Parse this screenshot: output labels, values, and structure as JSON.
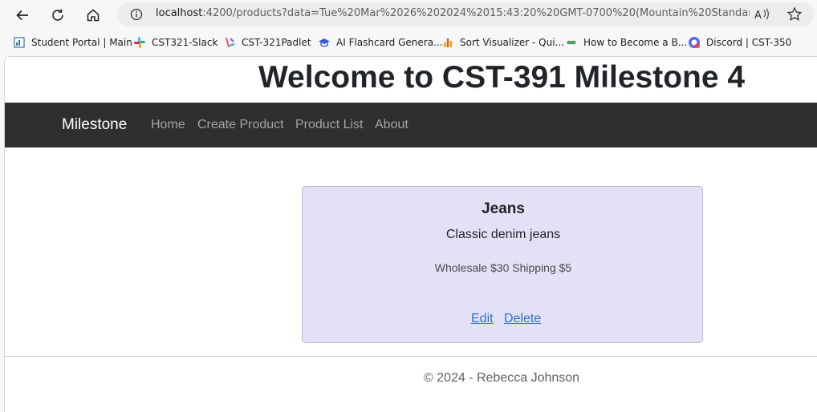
{
  "browser": {
    "url_host": "localhost",
    "url_rest": ":4200/products?data=Tue%20Mar%2026%202024%2015:43:20%20GMT-0700%20(Mountain%20Standard%2...",
    "read_aloud": "A̩)",
    "bookmarks": [
      {
        "label": "Student Portal | Main",
        "icon": "student-portal-icon"
      },
      {
        "label": "CST321-Slack",
        "icon": "slack-icon"
      },
      {
        "label": "CST-321Padlet",
        "icon": "padlet-icon"
      },
      {
        "label": "AI Flashcard Genera...",
        "icon": "graduation-cap-icon"
      },
      {
        "label": "Sort Visualizer - Qui...",
        "icon": "bar-chart-icon"
      },
      {
        "label": "How to Become a B...",
        "icon": "infinity-icon"
      },
      {
        "label": "Discord | CST-350",
        "icon": "discord-icon"
      }
    ]
  },
  "page": {
    "heading": "Welcome to CST-391 Milestone 4",
    "navbar": {
      "brand": "Milestone",
      "links": [
        "Home",
        "Create Product",
        "Product List",
        "About"
      ]
    },
    "product": {
      "name": "Jeans",
      "description": "Classic denim jeans",
      "pricing": "Wholesale $30 Shipping $5",
      "edit_label": "Edit",
      "delete_label": "Delete"
    },
    "footer": "© 2024 - Rebecca Johnson"
  }
}
